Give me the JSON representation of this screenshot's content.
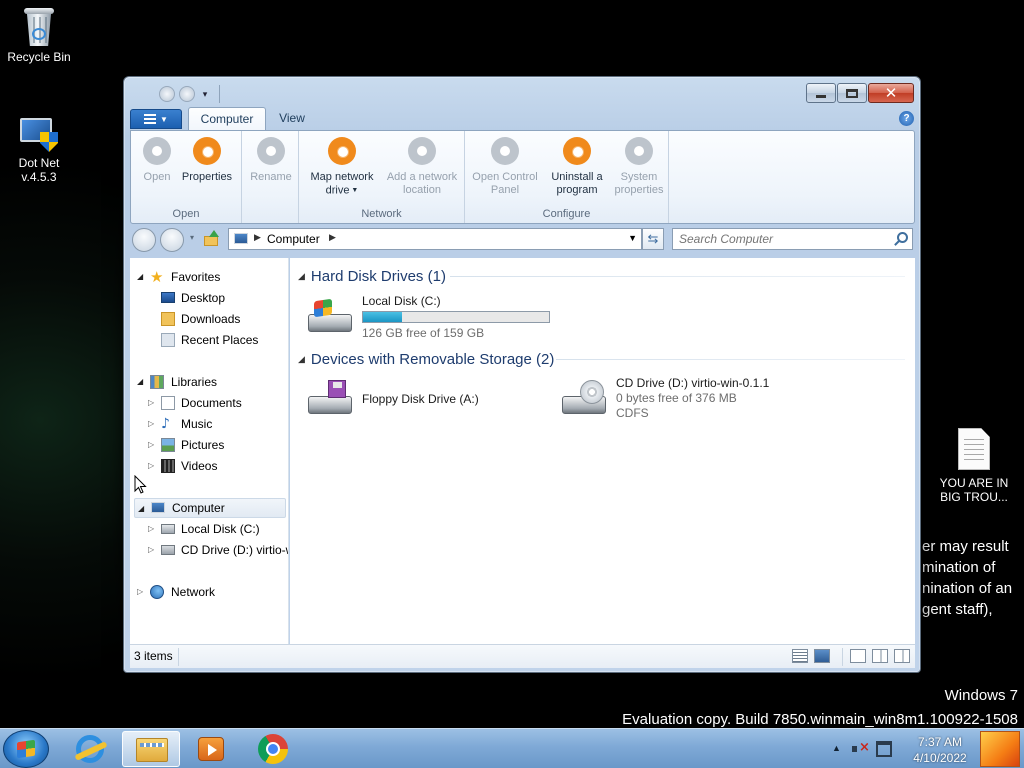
{
  "desktop": {
    "icons": [
      {
        "label": "Recycle Bin"
      },
      {
        "label": "Dot Net v.4.5.3"
      },
      {
        "label": "YOU ARE IN BIG TROU..."
      }
    ],
    "ransom_lines": [
      "er may result",
      "mination of",
      "nination of an",
      "gent staff),"
    ],
    "watermark_line1": "Windows 7",
    "watermark_line2": "Evaluation copy. Build 7850.winmain_win8m1.100922-1508"
  },
  "window": {
    "tabs": {
      "active": "Computer",
      "other": "View"
    },
    "ribbon": {
      "groups": [
        {
          "name": "Open",
          "buttons": [
            {
              "label": "Open",
              "enabled": false
            },
            {
              "label": "Properties",
              "enabled": true
            }
          ]
        },
        {
          "name": "",
          "buttons": [
            {
              "label": "Rename",
              "enabled": false
            }
          ]
        },
        {
          "name": "Network",
          "buttons": [
            {
              "label_line1": "Map network",
              "label_line2": "drive",
              "enabled": true
            },
            {
              "label_line1": "Add a network",
              "label_line2": "location",
              "enabled": false
            }
          ]
        },
        {
          "name": "Configure",
          "buttons": [
            {
              "label_line1": "Open Control",
              "label_line2": "Panel",
              "enabled": false
            },
            {
              "label_line1": "Uninstall a",
              "label_line2": "program",
              "enabled": true
            },
            {
              "label_line1": "System",
              "label_line2": "properties",
              "enabled": false
            }
          ]
        }
      ]
    },
    "address": {
      "crumb": "Computer"
    },
    "search": {
      "placeholder": "Search Computer"
    },
    "nav": {
      "favorites": {
        "label": "Favorites",
        "items": [
          "Desktop",
          "Downloads",
          "Recent Places"
        ]
      },
      "libraries": {
        "label": "Libraries",
        "items": [
          "Documents",
          "Music",
          "Pictures",
          "Videos"
        ]
      },
      "computer": {
        "label": "Computer",
        "items": [
          "Local Disk (C:)",
          "CD Drive (D:) virtio-w"
        ]
      },
      "network": {
        "label": "Network"
      }
    },
    "content": {
      "hdd_group": "Hard Disk Drives (1)",
      "removable_group": "Devices with Removable Storage (2)",
      "local_disk": {
        "name": "Local Disk (C:)",
        "free_text": "126 GB free of 159 GB",
        "used_fraction": 0.21
      },
      "floppy": {
        "name": "Floppy Disk Drive (A:)"
      },
      "cd": {
        "name": "CD Drive (D:) virtio-win-0.1.1",
        "free_text": "0 bytes free of 376 MB",
        "fs": "CDFS"
      }
    },
    "status": {
      "count": "3 items"
    }
  },
  "taskbar": {
    "time": "7:37 AM",
    "date": "4/10/2022"
  }
}
